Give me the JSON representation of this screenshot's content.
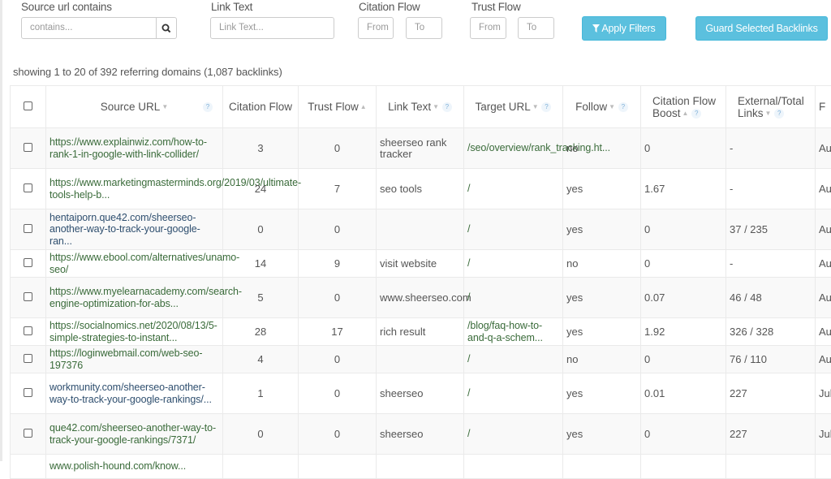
{
  "filters": {
    "source_url_label": "Source url contains",
    "source_url_placeholder": "contains...",
    "link_text_label": "Link Text",
    "link_text_placeholder": "Link Text...",
    "citation_flow_label": "Citation Flow",
    "citation_from_placeholder": "From",
    "citation_to_placeholder": "To",
    "trust_flow_label": "Trust Flow",
    "trust_from_placeholder": "From",
    "trust_to_placeholder": "To",
    "apply_label": "Apply Filters",
    "guard_label": "Guard Selected Backlinks"
  },
  "summary": "showing 1 to 20 of 392 referring domains (1,087 backlinks)",
  "table": {
    "columns": [
      {
        "label": "Source URL",
        "sort": "▼",
        "help": "?"
      },
      {
        "label": "Citation Flow",
        "sort": "",
        "help": ""
      },
      {
        "label": "Trust Flow",
        "sort": "▲",
        "help": ""
      },
      {
        "label": "Link Text",
        "sort": "▼",
        "help": "?"
      },
      {
        "label": "Target URL",
        "sort": "▼",
        "help": "?"
      },
      {
        "label": "Follow",
        "sort": "▼",
        "help": "?"
      },
      {
        "label": "Citation Flow Boost",
        "sort": "▲",
        "help": "?"
      },
      {
        "label": "External/Total Links",
        "sort": "▼",
        "help": "?"
      },
      {
        "label": "F",
        "sort": "",
        "help": ""
      }
    ],
    "rows": [
      {
        "source": "https://www.explainwiz.com/how-to-rank-1-in-google-with-link-collider/",
        "cf": "3",
        "tf": "0",
        "link_text": "sheerseo rank tracker",
        "target": "/seo/overview/rank_tracking.ht...",
        "follow": "no",
        "boost": "0",
        "ext": "-",
        "date": "Au"
      },
      {
        "source": "https://www.marketingmasterminds.org/2019/03/ultimate-tools-help-b...",
        "cf": "24",
        "tf": "7",
        "link_text": "seo tools",
        "target": "/",
        "follow": "yes",
        "boost": "1.67",
        "ext": "-",
        "date": "Au"
      },
      {
        "source": "hentaiporn.que42.com/sheerseo-another-way-to-track-your-google-ran...",
        "cf": "0",
        "tf": "0",
        "link_text": "",
        "target": "/",
        "follow": "yes",
        "boost": "0",
        "ext": "37 / 235",
        "date": "Au"
      },
      {
        "source": "https://www.ebool.com/alternatives/unamo-seo/",
        "cf": "14",
        "tf": "9",
        "link_text": "visit website",
        "target": "/",
        "follow": "no",
        "boost": "0",
        "ext": "-",
        "date": "Au"
      },
      {
        "source": "https://www.myelearnacademy.com/search-engine-optimization-for-abs...",
        "cf": "5",
        "tf": "0",
        "link_text": "www.sheerseo.com",
        "target": "/",
        "follow": "yes",
        "boost": "0.07",
        "ext": "46 / 48",
        "date": "Au"
      },
      {
        "source": "https://socialnomics.net/2020/08/13/5-simple-strategies-to-instant...",
        "cf": "28",
        "tf": "17",
        "link_text": "rich result",
        "target": "/blog/faq-how-to-and-q-a-schem...",
        "follow": "yes",
        "boost": "1.92",
        "ext": "326 / 328",
        "date": "Au"
      },
      {
        "source": "https://loginwebmail.com/web-seo-197376",
        "cf": "4",
        "tf": "0",
        "link_text": "",
        "target": "/",
        "follow": "no",
        "boost": "0",
        "ext": "76 / 110",
        "date": "Au"
      },
      {
        "source": "workmunity.com/sheerseo-another-way-to-track-your-google-rankings/...",
        "cf": "1",
        "tf": "0",
        "link_text": "sheerseo",
        "target": "/",
        "follow": "yes",
        "boost": "0.01",
        "ext": "227",
        "date": "Jul"
      },
      {
        "source": "que42.com/sheerseo-another-way-to-track-your-google-rankings/7371/",
        "cf": "0",
        "tf": "0",
        "link_text": "sheerseo",
        "target": "/",
        "follow": "yes",
        "boost": "0",
        "ext": "227",
        "date": "Jul"
      },
      {
        "source": "www.polish-hound.com/know...",
        "cf": "",
        "tf": "",
        "link_text": "",
        "target": "",
        "follow": "",
        "boost": "",
        "ext": "",
        "date": ""
      }
    ]
  },
  "colors": {
    "button_bg": "#5bc0de",
    "link_green": "#3a6b3a",
    "link_blue": "#2f4f6f"
  }
}
